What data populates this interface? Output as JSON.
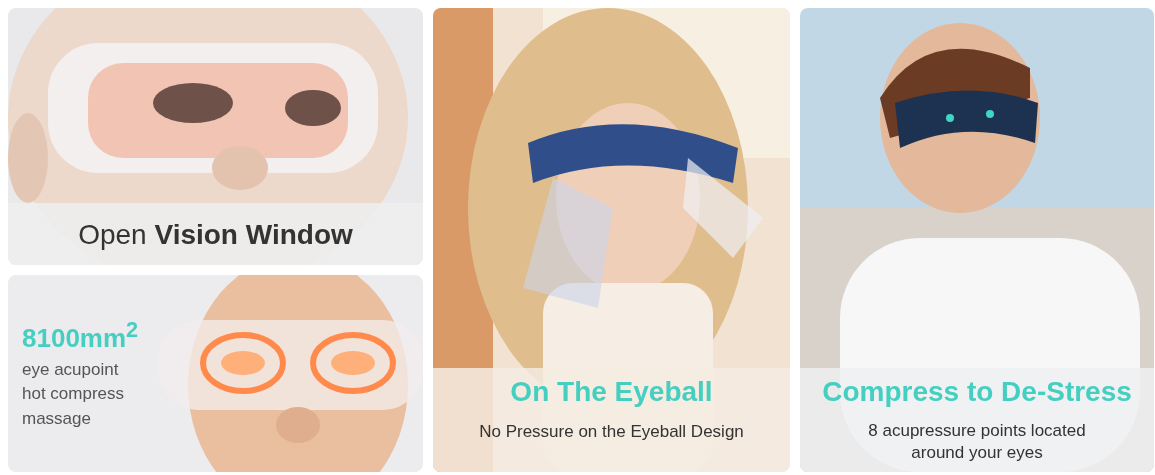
{
  "panels": [
    {
      "kind": "picture",
      "title": "Open **Vision Window**"
    },
    {
      "kind": "picture",
      "title": "8100mm$^{2}$",
      "caption": "eye acupoint hot compress massage"
    },
    {
      "kind": "picture",
      "title": "On The Eyeball",
      "caption": "No Pressure on the Eyeball Design"
    },
    {
      "kind": "picture",
      "title": "Compress to De-Stress",
      "caption": "8 acupressure points located around your eyes"
    }
  ]
}
